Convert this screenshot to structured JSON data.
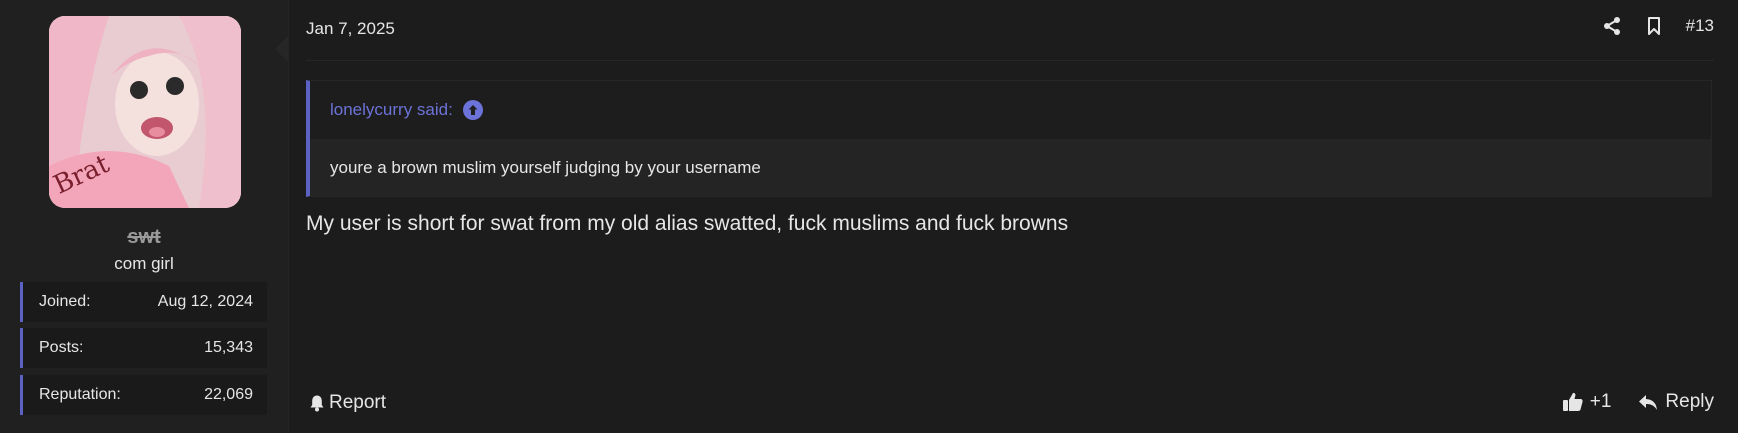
{
  "user": {
    "name": "swt",
    "title": "com girl",
    "avatar_icon": "user-avatar-photo",
    "avatar_lettering": "Brat",
    "stats": [
      {
        "label": "Joined:",
        "value": "Aug 12, 2024"
      },
      {
        "label": "Posts:",
        "value": "15,343"
      },
      {
        "label": "Reputation:",
        "value": "22,069"
      }
    ]
  },
  "post": {
    "date": "Jan 7, 2025",
    "number": "#13",
    "quote": {
      "author_said": "lonelycurry said:",
      "text": "youre a brown muslim yourself judging by your username"
    },
    "body": "My user is short for swat from my old alias swatted, fuck muslims and fuck browns"
  },
  "actions": {
    "report_label": "Report",
    "reaction_count": "+1",
    "reply_label": "Reply"
  },
  "colors": {
    "accent": "#5c62c4",
    "quote_link": "#6c73d8",
    "background": "#1c1c1c"
  }
}
